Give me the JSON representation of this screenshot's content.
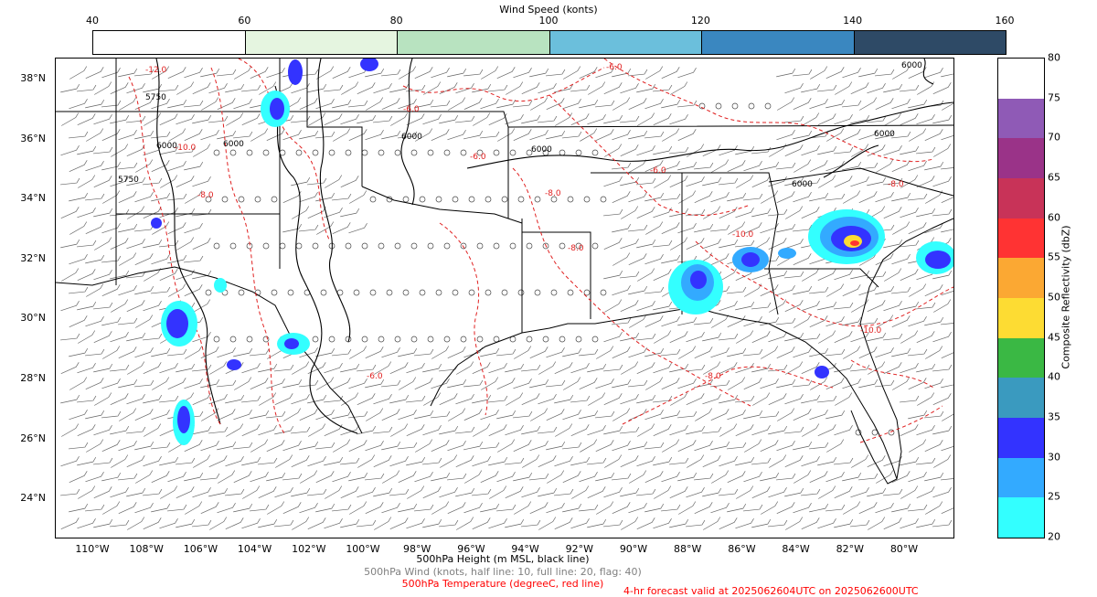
{
  "wind_legend": {
    "title": "Wind Speed (konts)",
    "ticks": [
      "40",
      "60",
      "80",
      "100",
      "120",
      "140",
      "160"
    ],
    "colors": [
      "#ffffff",
      "#e5f5e0",
      "#b8e3c0",
      "#6bbfdc",
      "#3a87c0",
      "#2e4a66"
    ]
  },
  "reflectivity_legend": {
    "title": "Composite Reflectivity (dbZ)",
    "ticks": [
      "20",
      "25",
      "30",
      "35",
      "40",
      "45",
      "50",
      "55",
      "60",
      "65",
      "70",
      "75",
      "80"
    ],
    "colors": [
      "#33ffff",
      "#33aaff",
      "#3333ff",
      "#3a9abf",
      "#3ab844",
      "#fddc33",
      "#fba833",
      "#ff3333",
      "#c83358",
      "#9a3388",
      "#8f5ab6",
      "#ffffff"
    ]
  },
  "map": {
    "lat_labels": [
      "38°N",
      "36°N",
      "34°N",
      "32°N",
      "30°N",
      "28°N",
      "26°N",
      "24°N"
    ],
    "lon_labels": [
      "110°W",
      "108°W",
      "106°W",
      "104°W",
      "102°W",
      "100°W",
      "98°W",
      "96°W",
      "94°W",
      "92°W",
      "90°W",
      "88°W",
      "86°W",
      "84°W",
      "82°W",
      "80°W"
    ],
    "contour_labels": [
      "6000",
      "5750",
      "6000",
      "6000",
      "6000",
      "5750",
      "6000",
      "6000",
      "6000"
    ],
    "temp_labels": [
      "-12.0",
      "-6.0",
      "-6.0",
      "-8.0",
      "-10.0",
      "-6.0",
      "-8.0",
      "-10.0",
      "-6.0",
      "-8.0",
      "-10.0",
      "-8.0",
      "-6.0",
      "-8.0"
    ]
  },
  "captions": {
    "height": "500hPa Height (m MSL, black line)",
    "wind": "500hPa Wind (knots, half line: 10, full line: 20, flag: 40)",
    "temp": "500hPa Temperature (degreeC, red line)",
    "forecast": "4-hr forecast valid at 2025062604UTC on 2025062600UTC"
  },
  "caption_colors": {
    "height": "#000000",
    "wind": "#808080",
    "temp": "#ff0000",
    "forecast": "#ff0000"
  }
}
